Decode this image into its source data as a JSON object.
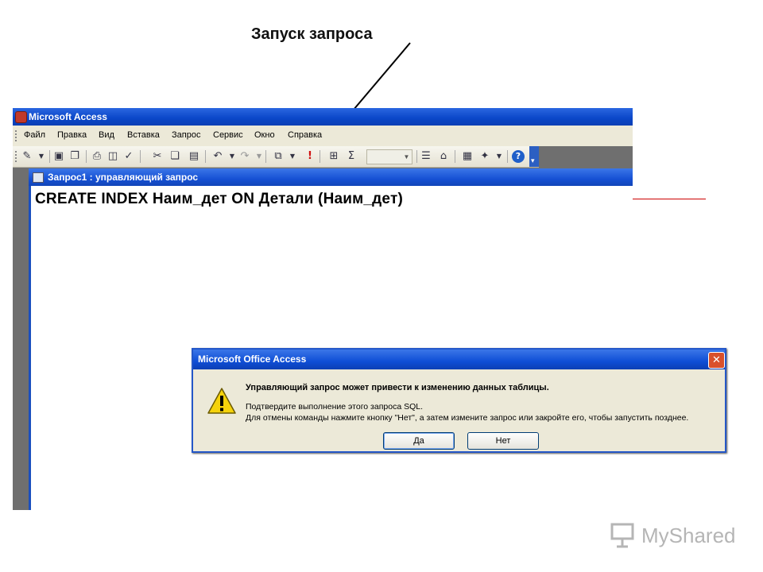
{
  "annotation": {
    "label": "Запуск запроса"
  },
  "app": {
    "title": "Microsoft Access",
    "menu": [
      "Файл",
      "Правка",
      "Вид",
      "Вставка",
      "Запрос",
      "Сервис",
      "Окно",
      "Справка"
    ],
    "toolbar_icons": [
      "design-view-icon",
      "save-icon",
      "properties-icon",
      "print-icon",
      "print-preview-icon",
      "spelling-icon",
      "cut-icon",
      "copy-icon",
      "paste-icon",
      "undo-icon",
      "redo-icon",
      "query-type-icon",
      "run-icon",
      "show-table-icon",
      "totals-icon",
      "top-values-combo",
      "properties-sheet-icon",
      "build-icon",
      "database-window-icon",
      "new-object-icon",
      "help-icon"
    ]
  },
  "query_window": {
    "title": "Запрос1 : управляющий запрос",
    "sql": "CREATE INDEX Наим_дет ON Детали (Наим_дет)"
  },
  "dialog": {
    "title": "Microsoft Office Access",
    "message_main": "Управляющий запрос может привести к изменению данных таблицы.",
    "message_line1": "Подтвердите выполнение этого запроса SQL.",
    "message_line2": "Для отмены команды нажмите кнопку \"Нет\", а затем измените запрос или закройте его, чтобы запустить позднее.",
    "yes_label": "Да",
    "no_label": "Нет",
    "close_label": "✕"
  },
  "watermark": {
    "text": "MyShared"
  }
}
